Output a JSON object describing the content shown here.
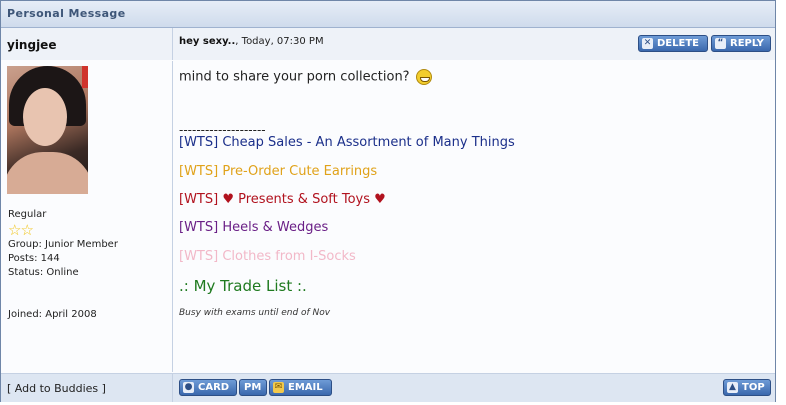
{
  "header": {
    "title": "Personal Message"
  },
  "user": {
    "name": "yingjee",
    "rank": "Regular",
    "group": "Group: Junior Member",
    "posts": "Posts: 144",
    "status": "Status: Online",
    "joined": "Joined: April 2008"
  },
  "post": {
    "subject": "hey sexy..",
    "date": ", Today, 07:30 PM",
    "body": "mind to share your porn collection?",
    "separator": "--------------------"
  },
  "buttons": {
    "delete": "DELETE",
    "reply": "REPLY",
    "card": "CARD",
    "pm": "PM",
    "email": "EMAIL",
    "top": "TOP",
    "add_buddy": "[ Add to Buddies ]"
  },
  "signature": {
    "links": [
      {
        "tag": "[WTS]",
        "text": " Cheap Sales - An Assortment of Many Things",
        "color": "#1b2f8a",
        "tag_color": "#1b2f8a"
      },
      {
        "tag": "[WTS]",
        "text": " Pre-Order Cute Earrings",
        "color": "#e0a21a",
        "tag_color": "#e0a21a"
      },
      {
        "tag": "[WTS]",
        "text": " ♥ Presents & Soft Toys ♥",
        "color": "#b1121e",
        "tag_color": "#b1121e"
      },
      {
        "tag": "[WTS]",
        "text": " Heels & Wedges",
        "color": "#6a1f86",
        "tag_color": "#6a1f86"
      },
      {
        "tag": "[WTS]",
        "text": " Clothes from I-Socks",
        "color": "#f2b8c8",
        "tag_color": "#f2b8c8"
      }
    ],
    "trade_list": ".: My Trade List :.",
    "trade_color": "#1f7a1f",
    "note": "Busy with exams until end of Nov"
  },
  "colors": {
    "accent": "#3a68ad",
    "border": "#6f86a8"
  }
}
